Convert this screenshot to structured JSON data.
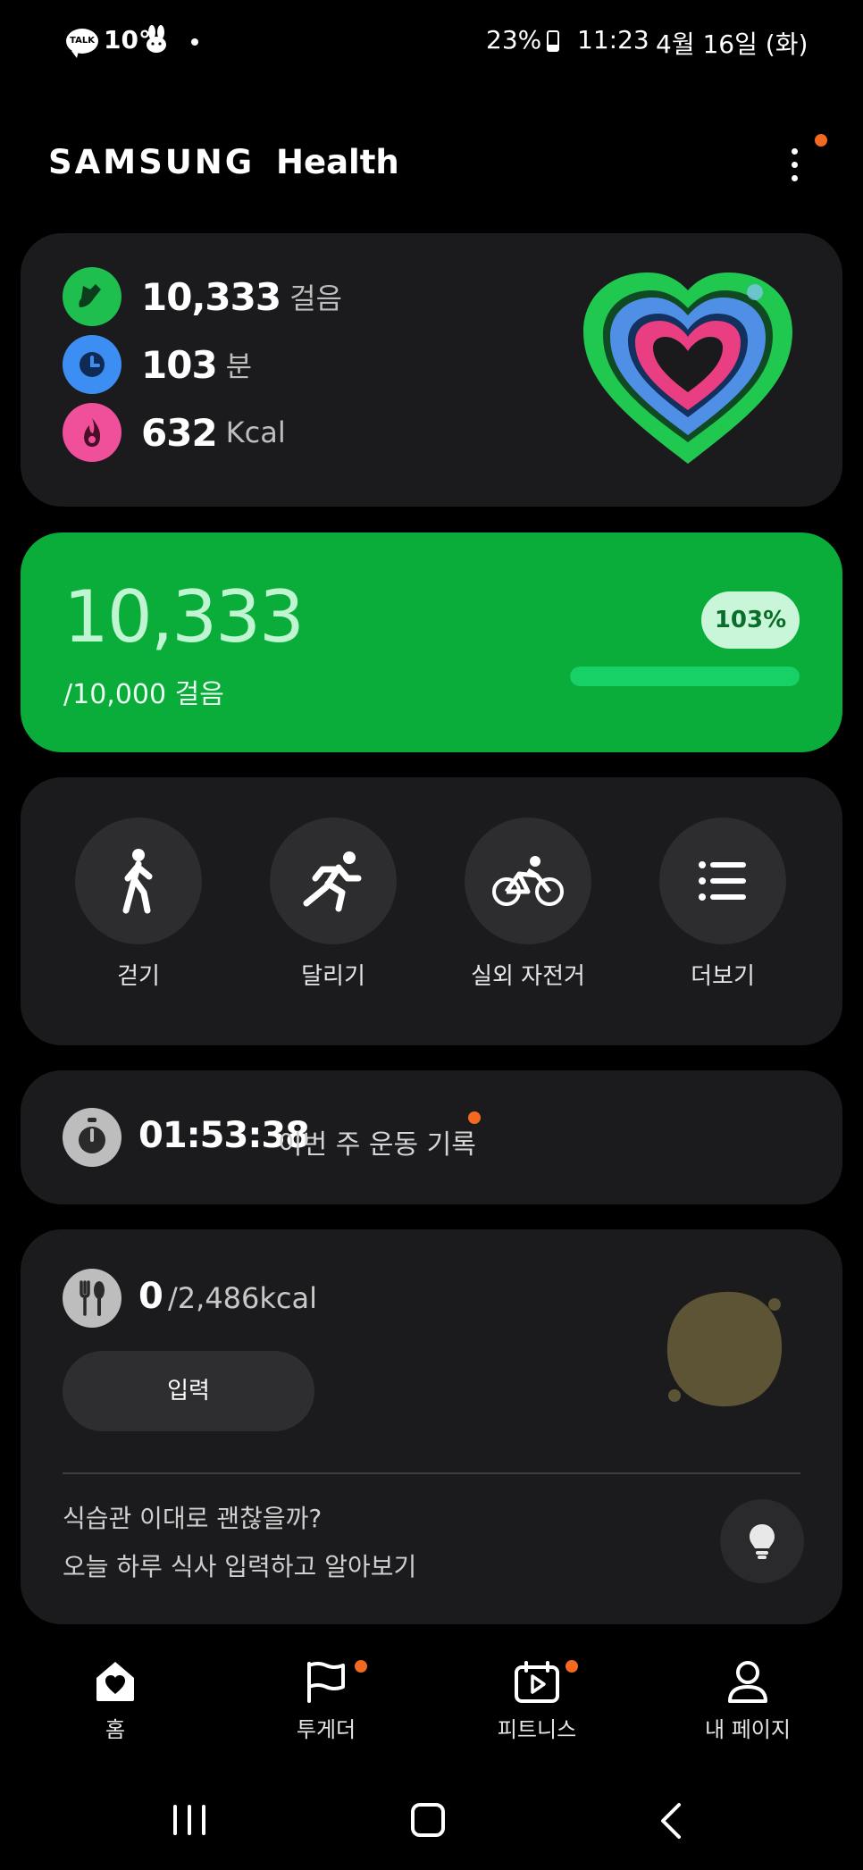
{
  "status_bar": {
    "talk_label": "TALK",
    "temperature": "10°",
    "battery": "23%",
    "time": "11:23",
    "date": "4월 16일 (화)"
  },
  "header": {
    "brand_main": "SAMSUNG",
    "brand_sub": "Health"
  },
  "summary": {
    "steps_value": "10,333",
    "steps_unit": "걸음",
    "minutes_value": "103",
    "minutes_unit": "분",
    "kcal_value": "632",
    "kcal_unit": "Kcal",
    "colors": {
      "steps": "#1fbf4f",
      "minutes": "#3d8ef2",
      "kcal": "#f0509a"
    }
  },
  "steps_card": {
    "value": "10,333",
    "goal": "/10,000 걸음",
    "percent_label": "103%",
    "progress": 1.0,
    "colors": {
      "background": "#0aac3a",
      "bar": "#17d066",
      "value_text": "#bff5d0"
    }
  },
  "activities": [
    {
      "label": "걷기",
      "icon": "walking-icon"
    },
    {
      "label": "달리기",
      "icon": "running-icon"
    },
    {
      "label": "실외 자전거",
      "icon": "bicycle-icon"
    },
    {
      "label": "더보기",
      "icon": "list-icon"
    }
  ],
  "workout": {
    "time": "01:53:38",
    "label": "이번 주 운동 기록"
  },
  "food": {
    "value": "0",
    "target": "/2,486kcal",
    "input_button": "입력",
    "tip_line1": "식습관 이대로 괜찮을까?",
    "tip_line2": "오늘 하루 식사 입력하고 알아보기"
  },
  "bottom_nav": [
    {
      "label": "홈",
      "icon": "home-heart-icon"
    },
    {
      "label": "투게더",
      "icon": "flag-icon"
    },
    {
      "label": "피트니스",
      "icon": "calendar-play-icon"
    },
    {
      "label": "내 페이지",
      "icon": "person-icon"
    }
  ],
  "accent": "#f26a21"
}
